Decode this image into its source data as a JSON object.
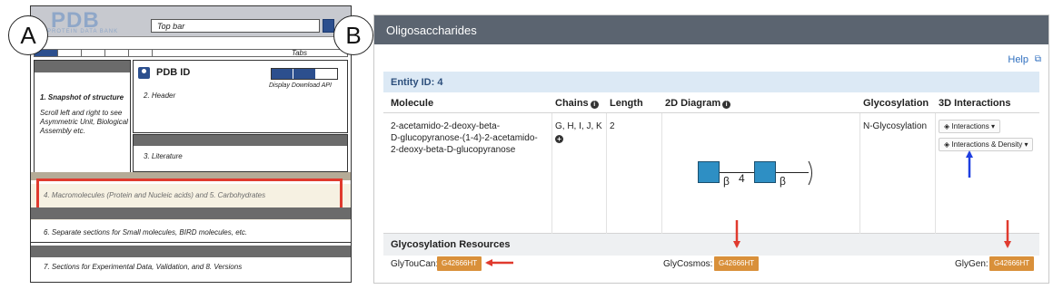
{
  "labels": {
    "a": "A",
    "b": "B"
  },
  "wireframe": {
    "logo_big": "PDB",
    "logo_small": "PROTEIN DATA BANK",
    "topbar": "Top bar",
    "tabs": "Tabs",
    "pdb_id": "PDB ID",
    "buttons_label": "Display  Download  API",
    "snapshot_title": "1. Snapshot of structure",
    "snapshot_desc": "Scroll left and right to see Asymmetric Unit, Biological Assembly etc.",
    "header": "2. Header",
    "literature": "3. Literature",
    "macromolecules": "4. Macromolecules (Protein and Nucleic acids) and 5. Carbohydrates",
    "separate": "6. Separate sections for Small molecules, BIRD molecules, etc.",
    "sections": "7. Sections for Experimental Data, Validation, and 8. Versions",
    "accent": "#2c4f8e",
    "highlight": "#e03a2e"
  },
  "panel": {
    "title": "Oligosaccharides",
    "help": "Help",
    "entity": "Entity ID: 4",
    "columns": {
      "molecule": "Molecule",
      "chains": "Chains",
      "length": "Length",
      "diagram": "2D Diagram",
      "glycosylation": "Glycosylation",
      "interactions": "3D Interactions"
    },
    "row": {
      "molecule_line1": "2-acetamido-2-deoxy-beta-",
      "molecule_line2": "D-glucopyranose-(1-4)-2-acetamido-",
      "molecule_line3": "2-deoxy-beta-D-glucopyranose",
      "chains": "G, H, I, J, K",
      "length": "2",
      "glycosylation": "N-Glycosylation",
      "interactions_btn": "Interactions",
      "density_btn": "Interactions & Density"
    },
    "diagram": {
      "beta1": "β",
      "link": "4",
      "beta2": "β",
      "block_color": "#2e8fc4"
    },
    "resources": {
      "heading": "Glycosylation Resources",
      "glytoucan": "GlyTouCan:",
      "glycosmos": "GlyCosmos:",
      "glygen": "GlyGen:",
      "accession": "G42666HT",
      "badge_color": "#d9903a"
    }
  }
}
